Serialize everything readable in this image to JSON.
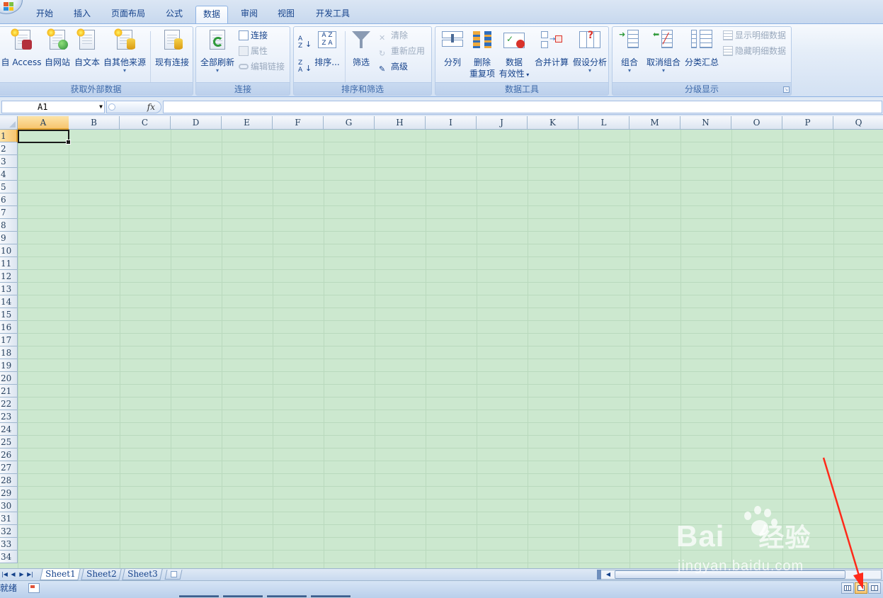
{
  "tabs": [
    "开始",
    "插入",
    "页面布局",
    "公式",
    "数据",
    "审阅",
    "视图",
    "开发工具"
  ],
  "active_tab": "数据",
  "ribbon": {
    "groups": {
      "external_data": {
        "label": "获取外部数据",
        "buttons": [
          "自 Access",
          "自网站",
          "自文本",
          "自其他来源",
          "现有连接"
        ]
      },
      "connections": {
        "label": "连接",
        "refresh_all": "全部刷新",
        "connections": "连接",
        "properties": "属性",
        "edit_links": "编辑链接"
      },
      "sort_filter": {
        "label": "排序和筛选",
        "sort": "排序...",
        "filter": "筛选",
        "clear": "清除",
        "reapply": "重新应用",
        "advanced": "高级"
      },
      "data_tools": {
        "label": "数据工具",
        "text_to_columns": "分列",
        "remove_duplicates_1": "删除",
        "remove_duplicates_2": "重复项",
        "validation_1": "数据",
        "validation_2": "有效性",
        "consolidate": "合并计算",
        "what_if": "假设分析"
      },
      "outline": {
        "label": "分级显示",
        "group": "组合",
        "ungroup": "取消组合",
        "subtotal": "分类汇总",
        "show_detail": "显示明细数据",
        "hide_detail": "隐藏明细数据"
      }
    }
  },
  "formula_bar": {
    "name_box": "A1",
    "fx": "fx",
    "value": ""
  },
  "columns": [
    "A",
    "B",
    "C",
    "D",
    "E",
    "F",
    "G",
    "H",
    "I",
    "J",
    "K",
    "L",
    "M",
    "N",
    "O",
    "P",
    "Q"
  ],
  "rows": [
    "1",
    "2",
    "3",
    "4",
    "5",
    "6",
    "7",
    "8",
    "9",
    "10",
    "11",
    "12",
    "13",
    "14",
    "15",
    "16",
    "17",
    "18",
    "19",
    "20",
    "21",
    "22",
    "23",
    "24",
    "25",
    "26",
    "27",
    "28",
    "29",
    "30",
    "31",
    "32",
    "33",
    "34"
  ],
  "selected_cell": "A1",
  "sheets": [
    "Sheet1",
    "Sheet2",
    "Sheet3"
  ],
  "active_sheet": "Sheet1",
  "status": {
    "text": "就绪"
  },
  "watermark": {
    "brand": "Bai",
    "brand_suffix": "经验",
    "url": "jingyan.baidu.com"
  },
  "colors": {
    "cell_background": "#cce8cf",
    "ribbon_text": "#15428b",
    "annotation_arrow": "#ff2a1a"
  }
}
